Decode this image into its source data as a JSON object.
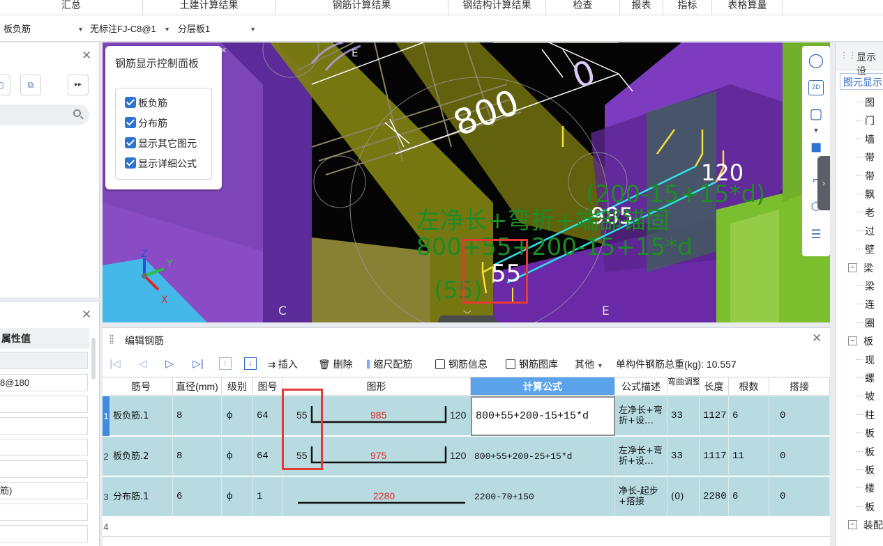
{
  "top_tabs": [
    "汇总",
    "土建计算结果",
    "钢筋计算结果",
    "钢结构计算结果",
    "检查",
    "报表",
    "指标",
    "表格算量"
  ],
  "filters": {
    "component_type": "板负筋",
    "component_name": "无标注FJ-C8@1",
    "layer": "分层板1"
  },
  "left_props": {
    "header": "属性值",
    "values": [
      "",
      "8@180",
      "",
      "",
      "",
      "",
      "筋)",
      "",
      ""
    ]
  },
  "control_panel": {
    "title": "钢筋显示控制面板",
    "options": [
      "板负筋",
      "分布筋",
      "显示其它图元",
      "显示详细公式"
    ]
  },
  "viewport": {
    "dim_800": "800",
    "dim_0": "0",
    "dim_120": "120",
    "dim_985": "985",
    "dim_55": "55",
    "formula_line1": "左净长+弯折+端部锚固",
    "formula_line2": "800+55+200-15+15*d",
    "formula_line3": "(200-15+15*d)",
    "formula_sub": "(55)",
    "axis_c": "C",
    "axis_e": "E",
    "axis_e_top": "E",
    "axis_x": "X",
    "axis_y": "Y",
    "axis_z": "Z"
  },
  "view_tools": {
    "two_d": "2D"
  },
  "edit_panel": {
    "title": "编辑钢筋",
    "toolbar": {
      "insert": "插入",
      "delete": "删除",
      "scale_rebar": "缩尺配筋",
      "rebar_info": "钢筋信息",
      "rebar_lib": "钢筋图库",
      "other": "其他",
      "total_weight": "单构件钢筋总重(kg): 10.557"
    },
    "columns": [
      "筋号",
      "直径(mm)",
      "级别",
      "图号",
      "图形",
      "计算公式",
      "公式描述",
      "弯曲调整",
      "长度",
      "根数",
      "搭接"
    ],
    "rows": [
      {
        "num": "1",
        "name": "板负筋.1",
        "diameter": "8",
        "grade": "ф",
        "fig": "64",
        "shape_left": "55",
        "shape_mid": "985",
        "shape_right": "120",
        "formula": "800+55+200-15+15*d",
        "desc_line1": "左净长+弯",
        "desc_line2": "折+设…",
        "bend": "33",
        "length": "1127",
        "count": "6",
        "lap": "0"
      },
      {
        "num": "2",
        "name": "板负筋.2",
        "diameter": "8",
        "grade": "ф",
        "fig": "64",
        "shape_left": "55",
        "shape_mid": "975",
        "shape_right": "120",
        "formula": "800+55+200-25+15*d",
        "desc_line1": "左净长+弯",
        "desc_line2": "折+设…",
        "bend": "33",
        "length": "1117",
        "count": "11",
        "lap": "0"
      },
      {
        "num": "3",
        "name": "分布筋.1",
        "diameter": "6",
        "grade": "ф",
        "fig": "1",
        "shape_mid": "2280",
        "formula": "2200-70+150",
        "desc_line1": "净长-起步",
        "desc_line2": "+搭接",
        "bend": "(0)",
        "length": "2280",
        "count": "6",
        "lap": "0"
      }
    ],
    "blank_row_num": "4"
  },
  "right_panel": {
    "header": "显示设",
    "tab": "图元显示",
    "items": [
      {
        "label": "图",
        "type": "leaf"
      },
      {
        "label": "门",
        "type": "leaf"
      },
      {
        "label": "墙",
        "type": "leaf"
      },
      {
        "label": "带",
        "type": "leaf"
      },
      {
        "label": "带",
        "type": "leaf"
      },
      {
        "label": "飘",
        "type": "leaf"
      },
      {
        "label": "老",
        "type": "leaf"
      },
      {
        "label": "过",
        "type": "leaf"
      },
      {
        "label": "壁",
        "type": "leaf"
      },
      {
        "label": "梁",
        "type": "group"
      },
      {
        "label": "梁",
        "type": "leaf"
      },
      {
        "label": "连",
        "type": "leaf"
      },
      {
        "label": "圈",
        "type": "leaf"
      },
      {
        "label": "板",
        "type": "group"
      },
      {
        "label": "现",
        "type": "leaf"
      },
      {
        "label": "螺",
        "type": "leaf"
      },
      {
        "label": "坡",
        "type": "leaf"
      },
      {
        "label": "柱",
        "type": "leaf"
      },
      {
        "label": "板",
        "type": "leaf"
      },
      {
        "label": "板",
        "type": "leaf"
      },
      {
        "label": "板",
        "type": "leaf"
      },
      {
        "label": "楼",
        "type": "leaf"
      },
      {
        "label": "板",
        "type": "leaf"
      },
      {
        "label": "装配",
        "type": "group"
      }
    ]
  },
  "colors": {
    "accent": "#2f73d1",
    "row_teal": "#b7dbe0",
    "active_header": "#5aa2ea",
    "highlight_red": "#e53935",
    "formula_green": "#1f8b25",
    "slab_purple": "#6f2fa8",
    "olive": "#8a8a18"
  }
}
